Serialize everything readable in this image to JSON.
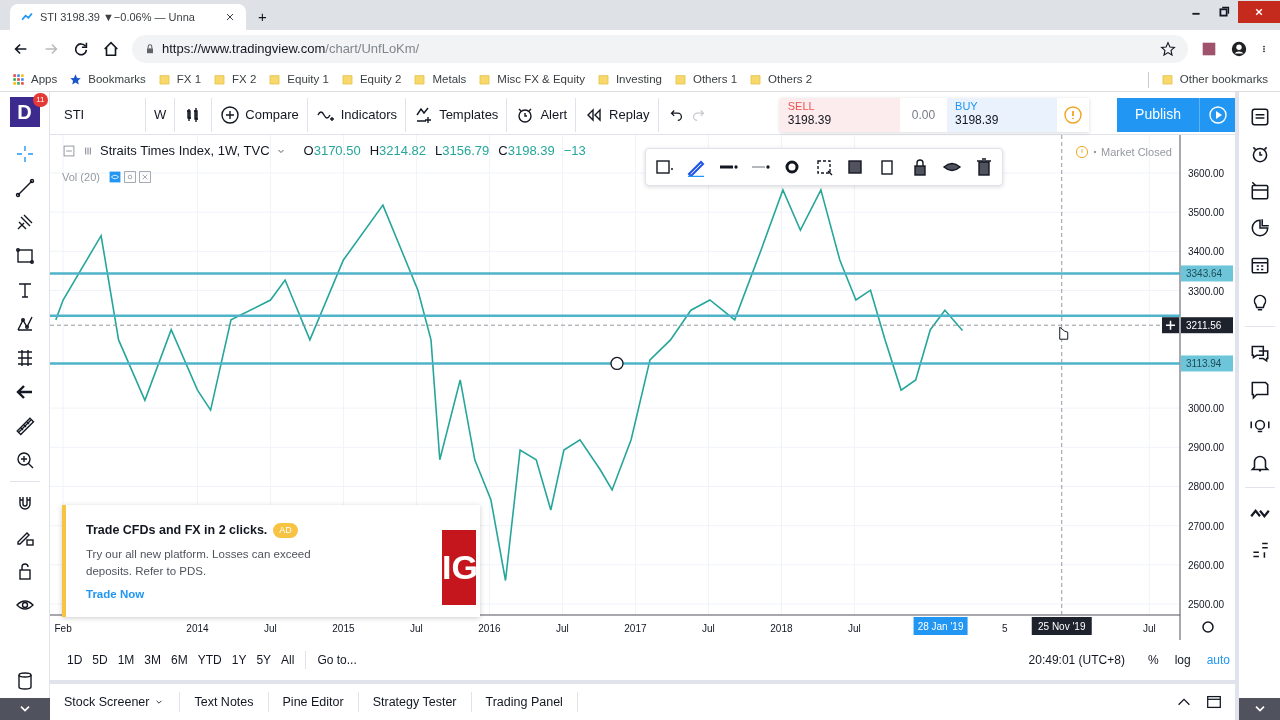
{
  "browser": {
    "tab_title": "STI 3198.39 ▼−0.06% — Unna",
    "new_tab": "+",
    "address_host": "https://www.tradingview.com",
    "address_path": "/chart/UnfLoKm/",
    "bookmarks": [
      {
        "label": "Apps",
        "kind": "apps"
      },
      {
        "label": "Bookmarks",
        "kind": "star"
      },
      {
        "label": "FX 1",
        "kind": "folder"
      },
      {
        "label": "FX 2",
        "kind": "folder"
      },
      {
        "label": "Equity 1",
        "kind": "folder"
      },
      {
        "label": "Equity 2",
        "kind": "folder"
      },
      {
        "label": "Metals",
        "kind": "folder"
      },
      {
        "label": "Misc FX & Equity",
        "kind": "folder"
      },
      {
        "label": "Investing",
        "kind": "folder"
      },
      {
        "label": "Others 1",
        "kind": "folder"
      },
      {
        "label": "Others 2",
        "kind": "folder"
      }
    ],
    "other_bookmarks": "Other bookmarks"
  },
  "header": {
    "logo": "D",
    "notification_count": "11",
    "symbol": "STI",
    "interval": "W",
    "buttons": [
      {
        "label": "Compare",
        "kind": "compare"
      },
      {
        "label": "Indicators",
        "kind": "indicators"
      },
      {
        "label": "Templates",
        "kind": "templates"
      },
      {
        "label": "Alert",
        "kind": "alert"
      },
      {
        "label": "Replay",
        "kind": "replay"
      }
    ],
    "publish": "Publish"
  },
  "trade": {
    "sell_label": "SELL",
    "sell_price": "3198.39",
    "spread": "0.00",
    "buy_label": "BUY",
    "buy_price": "3198.39"
  },
  "legend": {
    "title": "Straits Times Index, 1W, TVC",
    "values": [
      {
        "key": "O",
        "value": "3170.50"
      },
      {
        "key": "H",
        "value": "3214.82"
      },
      {
        "key": "L",
        "value": "3156.79"
      },
      {
        "key": "C",
        "value": "3198.39"
      }
    ],
    "change": "−13",
    "volume": "Vol (20)"
  },
  "market_status": "Market Closed",
  "chart_data": {
    "type": "line",
    "grid": true,
    "x": [
      2013.03,
      2013.08,
      2013.34,
      2013.46,
      2013.64,
      2013.82,
      2014.0,
      2014.09,
      2014.23,
      2014.5,
      2014.6,
      2014.77,
      2015.0,
      2015.27,
      2015.51,
      2015.6,
      2015.66,
      2015.8,
      2015.9,
      2016.01,
      2016.11,
      2016.21,
      2016.32,
      2016.42,
      2016.51,
      2016.62,
      2016.76,
      2016.84,
      2016.97,
      2017.1,
      2017.24,
      2017.38,
      2017.51,
      2017.68,
      2017.86,
      2018.01,
      2018.13,
      2018.27,
      2018.4,
      2018.51,
      2018.61,
      2018.71,
      2018.82,
      2018.92,
      2019.02,
      2019.12,
      2019.24
    ],
    "series": [
      {
        "color": "#26a69a",
        "values": [
          3225,
          3276,
          3440,
          3174,
          3020,
          3200,
          3046,
          2995,
          3225,
          3276,
          3327,
          3174,
          3378,
          3518,
          3301,
          3174,
          2868,
          3072,
          2868,
          2766,
          2560,
          2893,
          2868,
          2740,
          2893,
          2919,
          2842,
          2791,
          2919,
          3123,
          3174,
          3250,
          3276,
          3225,
          3403,
          3557,
          3454,
          3557,
          3378,
          3276,
          3301,
          3174,
          3046,
          3072,
          3200,
          3250,
          3198
        ]
      }
    ],
    "xlim": [
      2012.99,
      2020.73
    ],
    "ylim": [
      2472,
      3697
    ],
    "xticks": [
      {
        "value": 2013.08,
        "label": "Feb"
      },
      {
        "value": 2014,
        "label": "2014"
      },
      {
        "value": 2014.5,
        "label": "Jul"
      },
      {
        "value": 2015,
        "label": "2015"
      },
      {
        "value": 2015.5,
        "label": "Jul"
      },
      {
        "value": 2016,
        "label": "2016"
      },
      {
        "value": 2016.5,
        "label": "Jul"
      },
      {
        "value": 2017,
        "label": "2017"
      },
      {
        "value": 2017.5,
        "label": "Jul"
      },
      {
        "value": 2018,
        "label": "2018"
      },
      {
        "value": 2018.5,
        "label": "Jul"
      },
      {
        "value": 2020.52,
        "label": "Jul"
      }
    ],
    "yticks": [
      {
        "value": 2500,
        "label": "2500.00"
      },
      {
        "value": 2600,
        "label": "2600.00"
      },
      {
        "value": 2700,
        "label": "2700.00"
      },
      {
        "value": 2800,
        "label": "2800.00"
      },
      {
        "value": 2900,
        "label": "2900.00"
      },
      {
        "value": 3000,
        "label": "3000.00"
      },
      {
        "value": 3300,
        "label": "3300.00"
      },
      {
        "value": 3400,
        "label": "3400.00"
      },
      {
        "value": 3500,
        "label": "3500.00"
      },
      {
        "value": 3600,
        "label": "3600.00"
      }
    ],
    "ref_lines": [
      {
        "axis": "y",
        "value": 3343.64,
        "label": "3343.64"
      },
      {
        "axis": "y",
        "value": 3236
      },
      {
        "axis": "y",
        "value": 3113.94,
        "label": "3113.94"
      },
      {
        "axis": "x",
        "value": 2019.92,
        "label": "25 Nov '19"
      },
      {
        "axis": "y",
        "value": 3211.56,
        "label": "3211.56"
      }
    ]
  },
  "time_axis_extra": "5",
  "selection": {
    "time_label": "28 Jan '19"
  },
  "ad": {
    "title": "Trade CFDs and FX in 2 clicks.",
    "badge": "AD",
    "body": "Try our all new platform. Losses can exceed deposits. Refer to PDS.",
    "link": "Trade Now",
    "logo": "IG"
  },
  "ranges": [
    "1D",
    "5D",
    "1M",
    "3M",
    "6M",
    "YTD",
    "1Y",
    "5Y",
    "All"
  ],
  "goto": "Go to...",
  "clock": "20:49:01 (UTC+8)",
  "scale_options": [
    {
      "label": "%",
      "selected": false
    },
    {
      "label": "log",
      "selected": false
    },
    {
      "label": "auto",
      "selected": true
    }
  ],
  "bottom_tabs": [
    {
      "label": "Stock Screener",
      "dropdown": true
    },
    {
      "label": "Text Notes",
      "dropdown": false
    },
    {
      "label": "Pine Editor",
      "dropdown": false
    },
    {
      "label": "Strategy Tester",
      "dropdown": false
    },
    {
      "label": "Trading Panel",
      "dropdown": false
    }
  ]
}
